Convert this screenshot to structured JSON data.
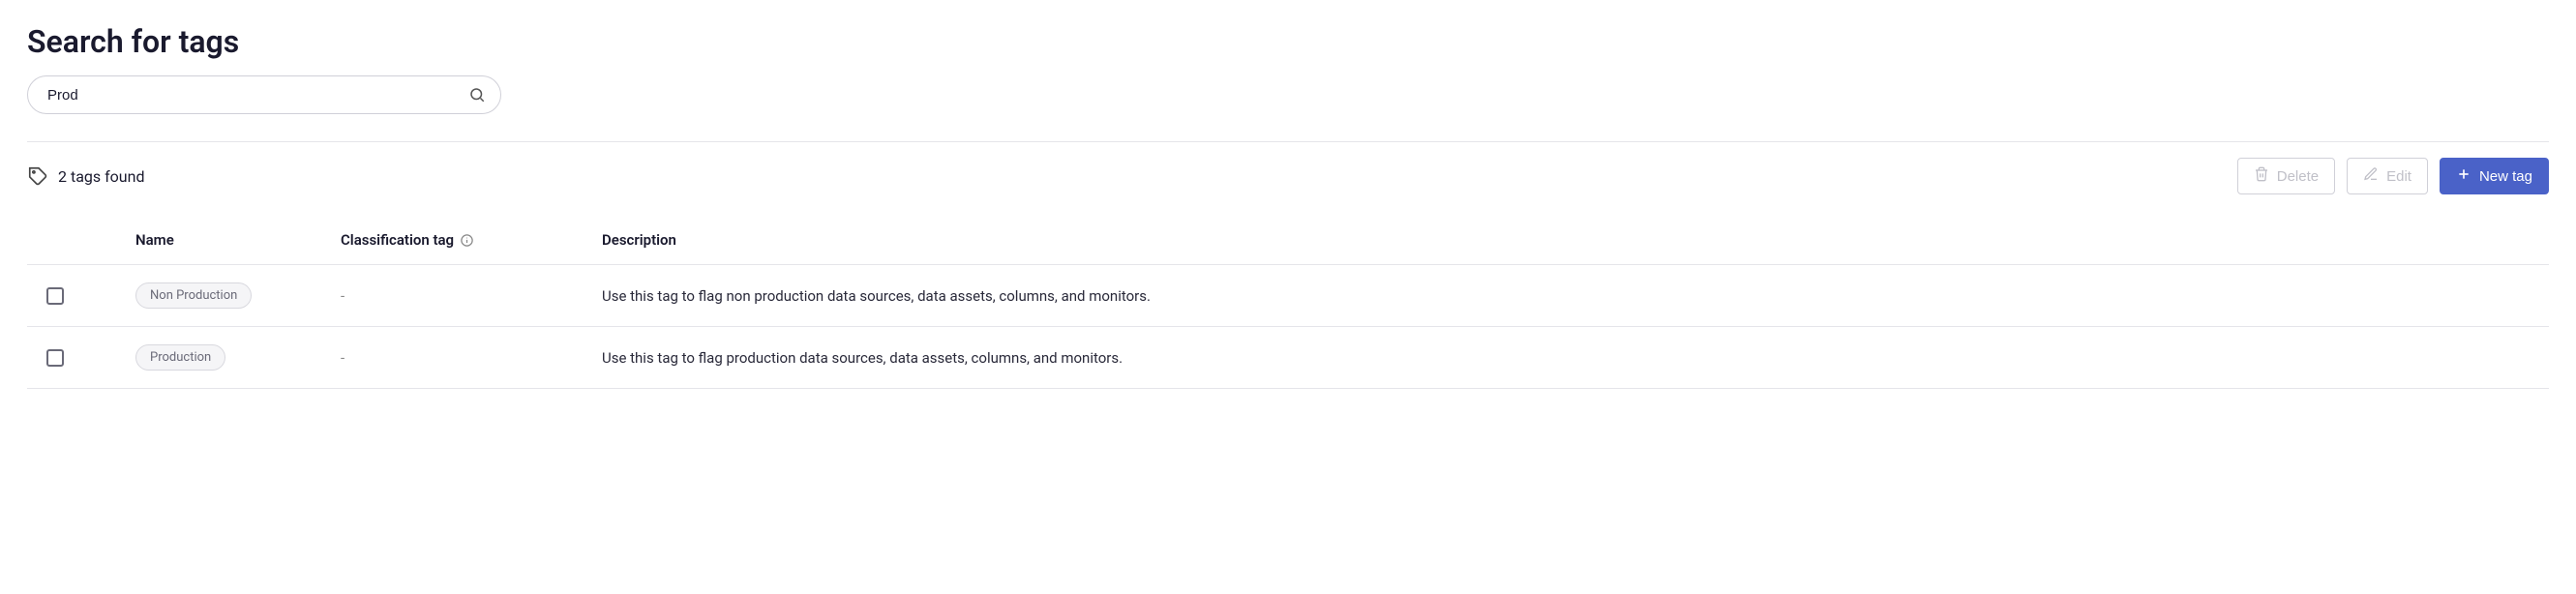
{
  "title": "Search for tags",
  "search": {
    "value": "Prod",
    "placeholder": ""
  },
  "found_label": "2 tags found",
  "actions": {
    "delete": "Delete",
    "edit": "Edit",
    "new_tag": "New tag"
  },
  "columns": {
    "name": "Name",
    "classification": "Classification tag",
    "description": "Description"
  },
  "rows": [
    {
      "name": "Non Production",
      "classification": "-",
      "description": "Use this tag to flag non production data sources, data assets, columns, and monitors."
    },
    {
      "name": "Production",
      "classification": "-",
      "description": "Use this tag to flag production data sources, data assets, columns, and monitors."
    }
  ]
}
